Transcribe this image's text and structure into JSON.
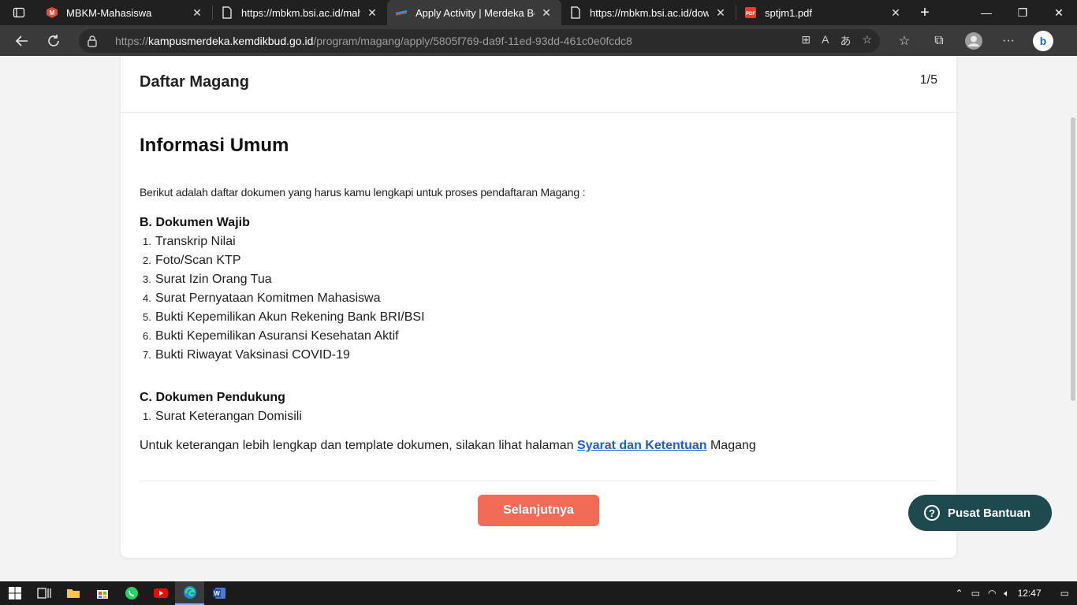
{
  "browser": {
    "tabs": [
      {
        "title": "MBKM-Mahasiswa",
        "icon": "mbkm-logo-icon",
        "active": false
      },
      {
        "title": "https://mbkm.bsi.ac.id/mahas",
        "icon": "page-icon",
        "active": false
      },
      {
        "title": "Apply Activity | Merdeka Bela",
        "icon": "kampus-merdeka-icon",
        "active": true
      },
      {
        "title": "https://mbkm.bsi.ac.id/downl",
        "icon": "page-icon",
        "active": false
      },
      {
        "title": "sptjm1.pdf",
        "icon": "pdf-icon",
        "active": false
      }
    ],
    "url_scheme": "https://",
    "url_host": "kampusmerdeka.kemdikbud.go.id",
    "url_path": "/program/magang/apply/5805f769-da9f-11ed-93dd-461c0e0fcdc8"
  },
  "page": {
    "card_title": "Daftar Magang",
    "step_count": "1/5",
    "section_title": "Informasi Umum",
    "intro": "Berikut adalah daftar dokumen yang harus kamu lengkapi untuk proses pendaftaran Magang :",
    "required_docs": {
      "heading": "B. Dokumen Wajib",
      "items": [
        {
          "num": "1.",
          "label": "Transkrip Nilai"
        },
        {
          "num": "2.",
          "label": "Foto/Scan KTP"
        },
        {
          "num": "3.",
          "label": "Surat Izin Orang Tua"
        },
        {
          "num": "4.",
          "label": "Surat Pernyataan Komitmen Mahasiswa"
        },
        {
          "num": "5.",
          "label": "Bukti Kepemilikan Akun Rekening Bank BRI/BSI"
        },
        {
          "num": "6.",
          "label": "Bukti Kepemilikan Asuransi Kesehatan Aktif"
        },
        {
          "num": "7.",
          "label": "Bukti Riwayat Vaksinasi COVID-19"
        }
      ]
    },
    "supporting_docs": {
      "heading": "C. Dokumen Pendukung",
      "items": [
        {
          "num": "1.",
          "label": "Surat Keterangan Domisili"
        }
      ]
    },
    "more_info_prefix": "Untuk keterangan lebih lengkap dan template dokumen, silakan lihat halaman ",
    "more_info_link": "Syarat dan Ketentuan",
    "more_info_suffix": " Magang",
    "next_button": "Selanjutnya",
    "help_button": "Pusat Bantuan"
  },
  "taskbar": {
    "time": "12:47"
  },
  "colors": {
    "accent_button": "#f26b57",
    "help_button": "#1e4a4f",
    "link": "#1a5fd0"
  }
}
